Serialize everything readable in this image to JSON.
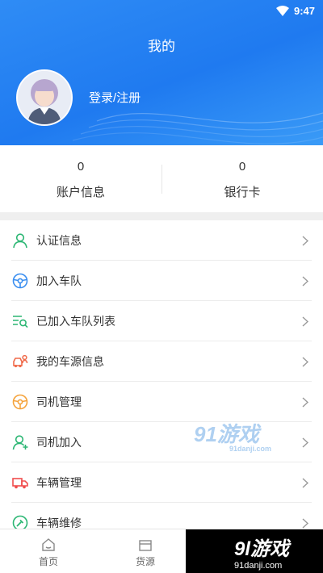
{
  "status_bar": {
    "time": "9:47"
  },
  "header": {
    "title": "我的",
    "login_text": "登录/注册"
  },
  "stats": [
    {
      "value": "0",
      "label": "账户信息"
    },
    {
      "value": "0",
      "label": "银行卡"
    }
  ],
  "menu": [
    {
      "label": "认证信息",
      "icon": "user-verify-icon",
      "color": "#2bb673"
    },
    {
      "label": "加入车队",
      "icon": "steering-wheel-icon",
      "color": "#3a8ef0"
    },
    {
      "label": "已加入车队列表",
      "icon": "list-search-icon",
      "color": "#2bb673"
    },
    {
      "label": "我的车源信息",
      "icon": "car-user-icon",
      "color": "#f06a4a"
    },
    {
      "label": "司机管理",
      "icon": "steering-wheel-icon",
      "color": "#f5a33b"
    },
    {
      "label": "司机加入",
      "icon": "user-add-icon",
      "color": "#2bb673"
    },
    {
      "label": "车辆管理",
      "icon": "truck-icon",
      "color": "#f04d4d"
    },
    {
      "label": "车辆维修",
      "icon": "wrench-icon",
      "color": "#2bb673"
    }
  ],
  "tabbar": {
    "home_label": "首页",
    "goods_label": "货源"
  },
  "watermarks": {
    "mid_brand": "91游戏",
    "mid_domain": "91danji.com",
    "corner_brand": "9l游戏",
    "corner_domain": "91danji.com"
  }
}
